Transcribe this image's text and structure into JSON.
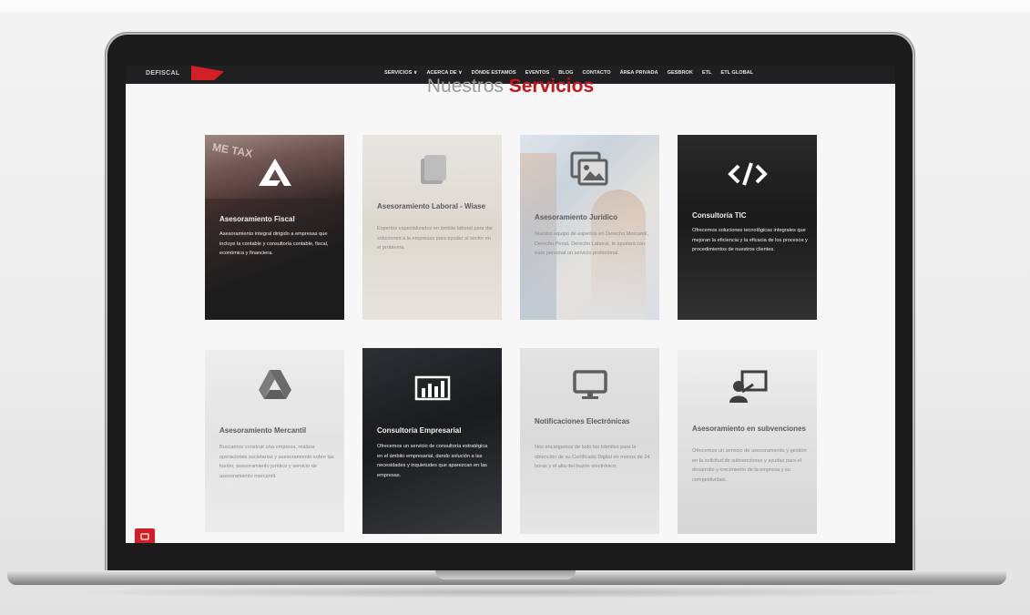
{
  "nav": {
    "logo": "DEFISCAL",
    "menu": [
      "SERVICIOS ∨",
      "ACERCA DE ∨",
      "DÓNDE ESTAMOS",
      "EVENTOS",
      "BLOG",
      "CONTACTO",
      "ÁREA PRIVADA",
      "GESBROK",
      "ETL",
      "ETL GLOBAL"
    ]
  },
  "section": {
    "heading_part1": "Nuestros",
    "heading_part2": "Servicios"
  },
  "cards": [
    {
      "icon": "arrow-logo-icon",
      "title": "Asesoramiento Fiscal",
      "desc": "Asesoramiento integral dirigido a empresas que incluye la contable y consultoría contable, fiscal, económica y financiera."
    },
    {
      "icon": "papers-icon",
      "title": "Asesoramiento Laboral - Wiase",
      "desc": "Expertos especializados en ámbito laboral para dar soluciones a la empresas para ayudar al sector en el problema."
    },
    {
      "icon": "image-gallery-icon",
      "title": "Asesoramiento Jurídico",
      "desc": "Nuestro equipo de expertos en Derecho Mercantil, Derecho Penal, Derecho Laboral, le ayudará con trato personal un servicio profesional."
    },
    {
      "icon": "code-icon",
      "title": "Consultoría TIC",
      "desc": "Ofrecemos soluciones tecnológicas integrales que mejoran la eficiencia y la eficacia de los procesos y procedimientos de nuestros clientes."
    },
    {
      "icon": "drive-triangle-icon",
      "title": "Asesoramiento Mercantil",
      "desc": "Buscamos construir una empresa, realizar operaciones societarias y asesoramiento sobre las fusión, asesoramiento jurídico y servicio de asesoramiento mercantil."
    },
    {
      "icon": "bar-chart-icon",
      "title": "Consultoría Empresarial",
      "desc": "Ofrecemos un servicio de consultoría estratégica en el ámbito empresarial, dando solución a las necesidades y inquietudes que aparezcan en las empresas."
    },
    {
      "icon": "monitor-icon",
      "title": "Notificaciones Electrónicas",
      "desc": "Nos encargamos de todo los trámites para la obtención de su Certificado Digital en menos de 24 horas y el alta del buzón electrónico."
    },
    {
      "icon": "presentation-icon",
      "title": "Asesoramiento en subvenciones",
      "desc": "Ofrecemos un servicio de asesoramiento y gestión en la solicitud de subvenciones y ayudas para el desarrollo y crecimiento de la empresa y su competitividad."
    }
  ],
  "colors": {
    "accent": "#c4161c",
    "nav_bg": "#202022",
    "dark_card": "#1e1e1f"
  }
}
